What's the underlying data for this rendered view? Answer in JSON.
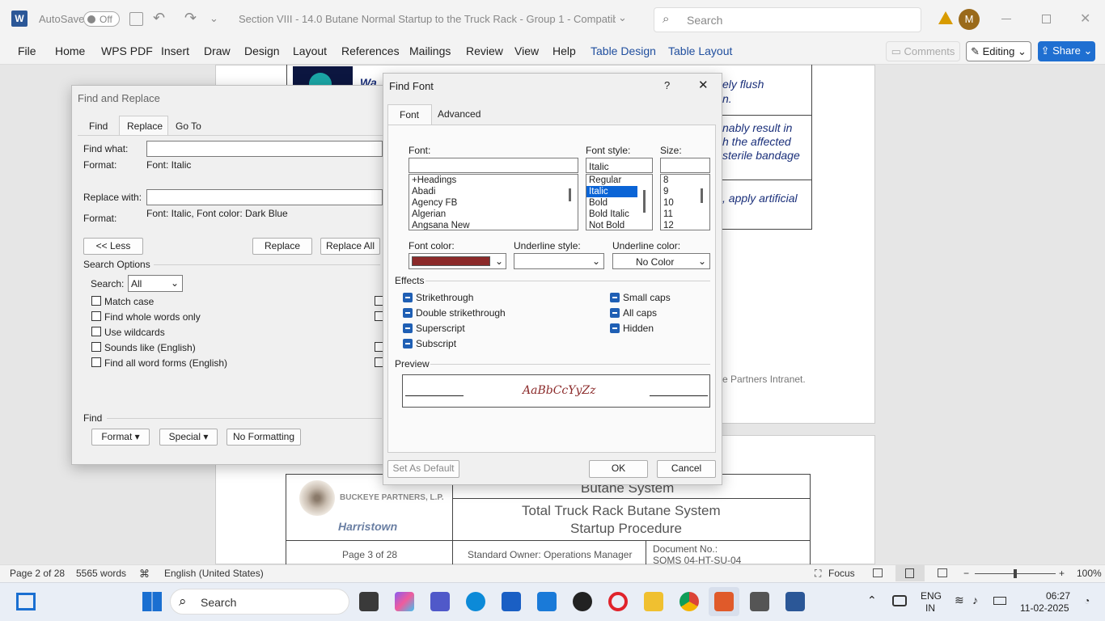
{
  "titlebar": {
    "autosave_label": "AutoSave",
    "autosave_state": "Off",
    "doc_title": "Section VIII - 14.0 Butane Normal Startup to the Truck Rack - Group 1  -  Compatibility...",
    "search_placeholder": "Search",
    "avatar_initial": "M",
    "word_letter": "W"
  },
  "ribbon": {
    "tabs": [
      "File",
      "Home",
      "WPS PDF",
      "Insert",
      "Draw",
      "Design",
      "Layout",
      "References",
      "Mailings",
      "Review",
      "View",
      "Help",
      "Table Design",
      "Table Layout"
    ],
    "comments_label": "Comments",
    "editing_label": "Editing",
    "share_label": "Share"
  },
  "document": {
    "lines": [
      "Wa",
      "ely flush",
      "n.",
      "nably result in",
      "h the affected",
      "sterile bandage",
      ", apply artificial"
    ],
    "intranet_text": "e Partners Intranet.",
    "company_name": "BUCKEYE PARTNERS, L.P.",
    "location": "Harristown",
    "system_title": "Butane System",
    "procedure_title_1": "Total Truck Rack Butane System",
    "procedure_title_2": "Startup Procedure",
    "page_label": "Page 3 of 28",
    "owner_label": "Standard Owner: Operations Manager",
    "docno_label": "Document No.:",
    "docno_value": "SOMS 04-HT-SU-04"
  },
  "find_replace": {
    "title": "Find and Replace",
    "tabs": [
      "Find",
      "Replace",
      "Go To"
    ],
    "find_what_label": "Find what:",
    "format_label": "Format:",
    "find_format": "Font: Italic",
    "replace_with_label": "Replace with:",
    "replace_format": "Font: Italic, Font color: Dark Blue",
    "less_button": "<< Less",
    "replace_button": "Replace",
    "replace_all_button": "Replace All",
    "search_options_label": "Search Options",
    "search_label": "Search:",
    "search_value": "All",
    "options": [
      "Match case",
      "Find whole words only",
      "Use wildcards",
      "Sounds like (English)",
      "Find all word forms (English)"
    ],
    "find_section_label": "Find",
    "format_button": "Format",
    "special_button": "Special",
    "no_formatting_button": "No Formatting"
  },
  "find_font": {
    "title": "Find Font",
    "help": "?",
    "close": "✕",
    "tabs": [
      "Font",
      "Advanced"
    ],
    "font_label": "Font:",
    "font_value": "",
    "font_list": [
      "+Headings",
      "Abadi",
      "Agency FB",
      "Algerian",
      "Angsana New"
    ],
    "style_label": "Font style:",
    "style_value": "Italic",
    "style_list": [
      "Regular",
      "Italic",
      "Bold",
      "Bold Italic",
      "Not Bold"
    ],
    "size_label": "Size:",
    "size_value": "",
    "size_list": [
      "8",
      "9",
      "10",
      "11",
      "12"
    ],
    "font_color_label": "Font color:",
    "font_color": "#8b2a2a",
    "underline_style_label": "Underline style:",
    "underline_color_label": "Underline color:",
    "underline_color_value": "No Color",
    "effects_label": "Effects",
    "effects_left": [
      "Strikethrough",
      "Double strikethrough",
      "Superscript",
      "Subscript"
    ],
    "effects_right": [
      "Small caps",
      "All caps",
      "Hidden"
    ],
    "preview_label": "Preview",
    "preview_text": "AaBbCcYyZz",
    "set_default_button": "Set As Default",
    "ok_button": "OK",
    "cancel_button": "Cancel"
  },
  "statusbar": {
    "page": "Page 2 of 28",
    "words": "5565 words",
    "language": "English (United States)",
    "focus": "Focus",
    "zoom": "100%"
  },
  "taskbar": {
    "search_label": "Search",
    "lang_1": "ENG",
    "lang_2": "IN",
    "time": "06:27",
    "date": "11-02-2025"
  }
}
